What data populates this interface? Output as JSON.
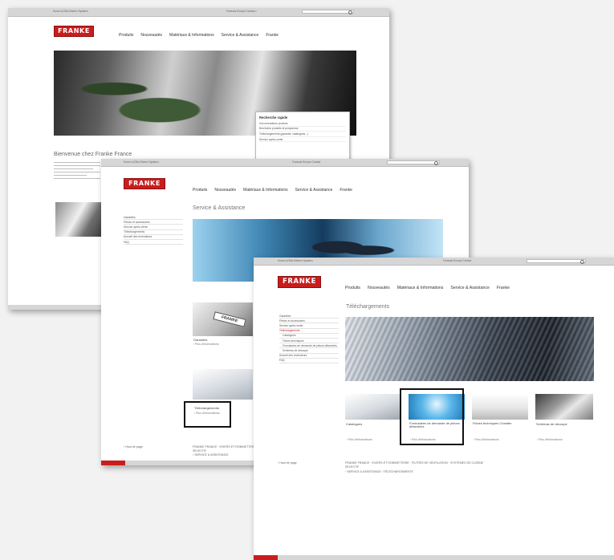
{
  "topbar": {
    "crumb_home": "Home",
    "crumb_section": "Kitchen Systems",
    "utility_text": "Francais  Europe  Contact  ▾",
    "utility_text_short": "Francais  Europe  Contact"
  },
  "brand": {
    "logo": "FRANKE"
  },
  "nav": {
    "items": [
      "Produits",
      "Nouveautés",
      "Matériaux & Informations",
      "Service & Assistance",
      "Franke"
    ]
  },
  "window1": {
    "quick_search": {
      "title": "Recherche rapide",
      "items": [
        "Vos revendeurs proches",
        "Brochures produits et prospectus",
        "Téléchargements (garantie, catalogues...)",
        "Service après-vente"
      ]
    },
    "welcome": "Bienvenue chez Franke France"
  },
  "window2": {
    "heading": "Service & Assistance",
    "sidebar": [
      "Garanties",
      "Pièces et accessoires",
      "Service après-vente",
      "Téléchargements",
      "Accueil des revendeurs",
      "FAQ"
    ],
    "card_garanties": {
      "label": "Garanties",
      "more": "› Plus d'informations"
    },
    "card_downloads": {
      "label": "Téléchargements",
      "more": "› Plus d'informations"
    },
    "footer_left": "‹ Haut de page",
    "footer_text": "FRANKE FRANCE · EVIERS ET ROBINETTERIE",
    "footer_text2": "SELECTIF",
    "footer_links": "› SERVICE & ASSISTANCE"
  },
  "window3": {
    "heading": "Téléchargements",
    "sidebar": [
      {
        "label": "Garanties",
        "level": 0,
        "active": false
      },
      {
        "label": "Pièces et accessoires",
        "level": 0,
        "active": false
      },
      {
        "label": "Service après-vente",
        "level": 0,
        "active": false
      },
      {
        "label": "Téléchargements",
        "level": 0,
        "active": true
      },
      {
        "label": "Catalogues",
        "level": 1,
        "active": false
      },
      {
        "label": "Fiches techniques",
        "level": 1,
        "active": false
      },
      {
        "label": "Formulaires de demande de pièces détachées",
        "level": 1,
        "active": false
      },
      {
        "label": "Schémas de découpe",
        "level": 1,
        "active": false
      },
      {
        "label": "Accueil des revendeurs",
        "level": 0,
        "active": false
      },
      {
        "label": "FAQ",
        "level": 0,
        "active": false
      }
    ],
    "cards": [
      {
        "label": "Catalogues",
        "more": "› Plus d'informations"
      },
      {
        "label": "Formulaires de demande de pièces détachées",
        "more": "› Plus d'informations"
      },
      {
        "label": "Fiches techniques Chantier",
        "more": "› Plus d'informations"
      },
      {
        "label": "Schémas de découpe",
        "more": "› Plus d'informations"
      }
    ],
    "footer_left": "‹ Haut de page",
    "footer_text": "FRANKE FRANCE · EVIERS ET ROBINETTERIE · FILTRES DE VENTILATION · SYSTÈMES DE CUISINE",
    "footer_text2": "SELECTIF",
    "footer_links": "› SERVICE & ASSISTANCE  › TÉLÉCHARGEMENTS"
  },
  "colors": {
    "brand_red": "#c91d1d",
    "page_bg": "#f2f2f2",
    "topbar": "#d6d6d6"
  }
}
